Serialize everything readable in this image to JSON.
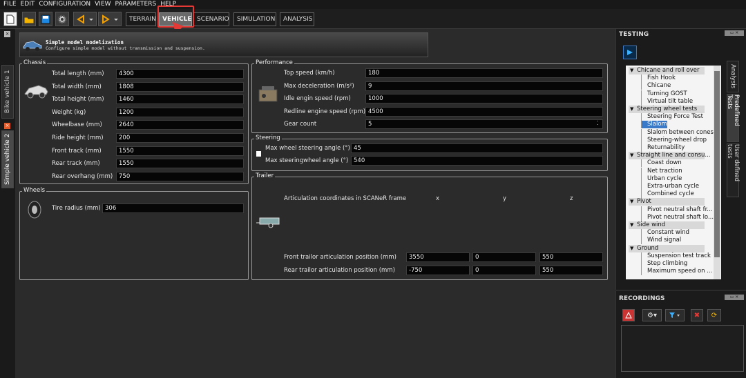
{
  "menu": [
    "FILE",
    "EDIT",
    "CONFIGURATION",
    "VIEW",
    "PARAMETERS",
    "HELP"
  ],
  "tabs": {
    "terrain": "TERRAIN",
    "vehicle": "VEHICLE",
    "scenario": "SCENARIO",
    "simulation": "SIMULATION",
    "analysis": "ANALYSIS"
  },
  "toolbar_icons": [
    "new-icon",
    "open-icon",
    "save-icon",
    "gear-icon",
    "prev-icon",
    "next-icon"
  ],
  "left_tabs": [
    "Bike vehicle 1",
    "Simple vehicle 2"
  ],
  "banner": {
    "title": "Simple model modelization",
    "subtitle": "Configure simple model without transmission and suspension."
  },
  "chassis": {
    "title": "Chassis",
    "rows": [
      {
        "label": "Total length (mm)",
        "value": "4300"
      },
      {
        "label": "Total width (mm)",
        "value": "1808"
      },
      {
        "label": "Total height (mm)",
        "value": "1460"
      },
      {
        "label": "Weight (kg)",
        "value": "1200"
      },
      {
        "label": "Wheelbase (mm)",
        "value": "2640"
      },
      {
        "label": "Ride height (mm)",
        "value": "200"
      },
      {
        "label": "Front track (mm)",
        "value": "1550"
      },
      {
        "label": "Rear track (mm)",
        "value": "1550"
      },
      {
        "label": "Rear overhang (mm)",
        "value": "750"
      }
    ]
  },
  "wheels": {
    "title": "Wheels",
    "label": "Tire radius (mm)",
    "value": "306"
  },
  "performance": {
    "title": "Performance",
    "rows": [
      {
        "label": "Top speed (km/h)",
        "value": "180"
      },
      {
        "label": "Max deceleration (m/s²)",
        "value": "9"
      },
      {
        "label": "Idle engin speed (rpm)",
        "value": "1000"
      },
      {
        "label": "Redline engine speed (rpm)",
        "value": "4500"
      },
      {
        "label": "Gear count",
        "value": "5"
      }
    ]
  },
  "steering": {
    "title": "Steering",
    "rows": [
      {
        "label": "Max wheel steering angle (°)",
        "value": "45"
      },
      {
        "label": "Max steeringwheel angle (°)",
        "value": "540"
      }
    ]
  },
  "trailer": {
    "title": "Trailer",
    "header": "Articulation coordinates in SCANeR frame",
    "cols": [
      "x",
      "y",
      "z"
    ],
    "rows": [
      {
        "label": "Front trailor articulation position (mm)",
        "values": [
          "3550",
          "0",
          "550"
        ]
      },
      {
        "label": "Rear trailor articulation position (mm)",
        "values": [
          "-750",
          "0",
          "550"
        ]
      }
    ]
  },
  "testing": {
    "title": "TESTING",
    "side_tabs": [
      "Analysis",
      "Predefined Tests",
      "User defined tests"
    ],
    "tree": [
      {
        "text": "Chicane and roll over",
        "cat": true
      },
      {
        "text": "Fish Hook"
      },
      {
        "text": "Chicane"
      },
      {
        "text": "Turning GOST"
      },
      {
        "text": "Virtual tilt table"
      },
      {
        "text": "Steering wheel tests",
        "cat": true
      },
      {
        "text": "Steering Force Test"
      },
      {
        "text": "Slalom",
        "selected": true
      },
      {
        "text": "Slalom between cones"
      },
      {
        "text": "Steering-wheel drop"
      },
      {
        "text": "Returnability"
      },
      {
        "text": "Straight line and consu...",
        "cat": true
      },
      {
        "text": "Coast down"
      },
      {
        "text": "Net traction"
      },
      {
        "text": "Urban cycle"
      },
      {
        "text": "Extra-urban cycle"
      },
      {
        "text": "Combined cycle"
      },
      {
        "text": "Pivot",
        "cat": true
      },
      {
        "text": "Pivot neutral shaft fr..."
      },
      {
        "text": "Pivot neutral shaft lo..."
      },
      {
        "text": "Side wind",
        "cat": true
      },
      {
        "text": "Constant wind"
      },
      {
        "text": "Wind signal"
      },
      {
        "text": "Ground",
        "cat": true
      },
      {
        "text": "Suspension test track"
      },
      {
        "text": "Step climbing"
      },
      {
        "text": "Maximum speed on ..."
      }
    ]
  },
  "recordings": {
    "title": "RECORDINGS"
  },
  "colors": {
    "highlight": "#e53935",
    "selected": "#3a78c8"
  }
}
